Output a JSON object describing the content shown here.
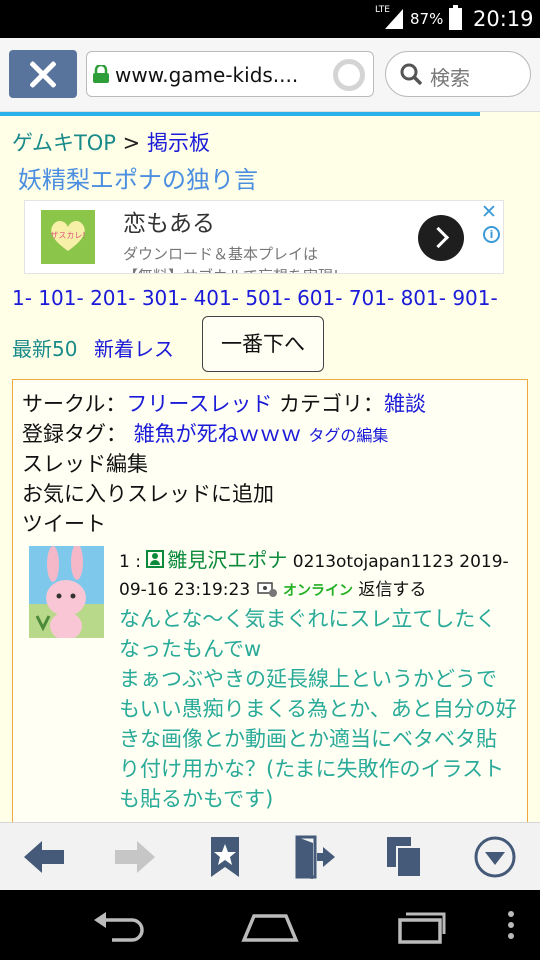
{
  "status_bar": {
    "network": "LTE",
    "battery": "87%",
    "time": "20:19"
  },
  "browser": {
    "url": "www.game-kids....",
    "search_placeholder": "検索"
  },
  "breadcrumb": {
    "home": "ゲムキTOP",
    "separator": ">",
    "board": "掲示板"
  },
  "thread_title": "妖精梨エポナの独り言",
  "ad": {
    "image_text": "ザスカレ!",
    "title": "恋もある",
    "body_line1": "ダウンロード＆基本プレイは",
    "body_line2": "【無料】サブカルで妄想を実現!",
    "close": "✕",
    "info": "i"
  },
  "page_links": [
    "1-",
    "101-",
    "201-",
    "301-",
    "401-",
    "501-",
    "601-",
    "701-",
    "801-",
    "901-"
  ],
  "nav": {
    "latest": "最新50",
    "new_replies": "新着レス",
    "to_bottom": "一番下へ"
  },
  "thread_info": {
    "circle_label": "サークル：",
    "circle_value": "フリースレッド",
    "category_label": " カテゴリ：",
    "category_value": "雑談",
    "tags_label": "登録タグ：",
    "tag_value": "雑魚が死ねｗｗｗ",
    "tag_edit": "タグの編集",
    "thread_edit": "スレッド編集",
    "favorite": "お気に入りスレッドに追加",
    "tweet": "ツイート"
  },
  "post": {
    "number": "1 :",
    "name": "雛見沢エポナ",
    "user_id": "0213otojapan1123",
    "datetime": "2019-09-16 23:19:23",
    "online": "オンライン",
    "reply": "返信する",
    "body": "なんとな～く気まぐれにスレ立てしたくなったもんでw\nまぁつぶやきの延長線上というかどうでもいい愚痴りまくる為とか、あと自分の好きな画像とか動画とか適当にベタベタ貼り付け用かな？(たまに失敗作のイラストも貼るかもです)"
  }
}
